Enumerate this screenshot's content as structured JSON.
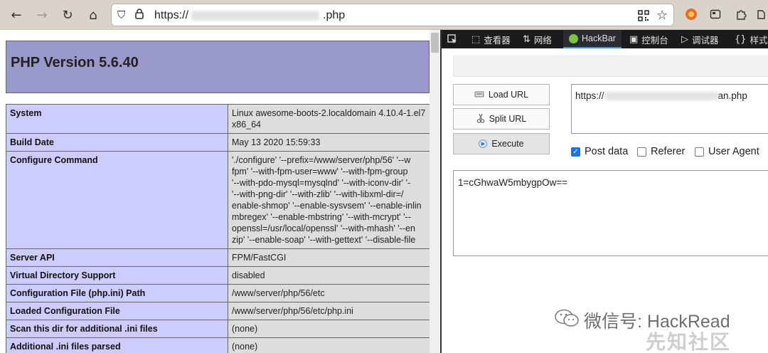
{
  "browser": {
    "url_prefix": "https://",
    "url_suffix": ".php",
    "icons": {
      "back": "←",
      "forward": "→",
      "reload": "↻",
      "home": "⌂",
      "shield": "⛉",
      "lock": "🔒",
      "qr": "▦",
      "star": "☆"
    }
  },
  "phpinfo": {
    "title": "PHP Version 5.6.40",
    "rows": [
      {
        "key": "System",
        "value": "Linux awesome-boots-2.localdomain 4.10.4-1.el7",
        "value2": "x86_64"
      },
      {
        "key": "Build Date",
        "value": "May 13 2020 15:59:33"
      },
      {
        "key": "Configure Command",
        "lines": [
          "'./configure' '--prefix=/www/server/php/56' '--w",
          "fpm' '--with-fpm-user=www' '--with-fpm-group",
          "'--with-pdo-mysql=mysqlnd' '--with-iconv-dir' '-",
          "'--with-png-dir' '--with-zlib' '--with-libxml-dir=/",
          "enable-shmop' '--enable-sysvsem' '--enable-inlin",
          "mbregex' '--enable-mbstring' '--with-mcrypt' '--",
          "openssl=/usr/local/openssl' '--with-mhash' '--en",
          "zip' '--enable-soap' '--with-gettext' '--disable-file"
        ]
      },
      {
        "key": "Server API",
        "value": "FPM/FastCGI"
      },
      {
        "key": "Virtual Directory Support",
        "value": "disabled"
      },
      {
        "key": "Configuration File (php.ini) Path",
        "value": "/www/server/php/56/etc"
      },
      {
        "key": "Loaded Configuration File",
        "value": "/www/server/php/56/etc/php.ini"
      },
      {
        "key": "Scan this dir for additional .ini files",
        "value": "(none)"
      },
      {
        "key": "Additional .ini files parsed",
        "value": "(none)"
      }
    ]
  },
  "devtools": {
    "tabs": [
      {
        "icon": "⬚",
        "label": "查看器"
      },
      {
        "icon": "⇅",
        "label": "网络"
      },
      {
        "icon": "",
        "label": "HackBar"
      },
      {
        "icon": "▣",
        "label": "控制台"
      },
      {
        "icon": "▷",
        "label": "调试器"
      },
      {
        "icon": "{}",
        "label": "样式"
      }
    ],
    "inspect_icon": "⬉"
  },
  "hackbar": {
    "load_url": "Load URL",
    "split_url": "Split URL",
    "execute": "Execute",
    "url_prefix": "https://",
    "url_suffix": "an.php",
    "post_data_label": "Post data",
    "referer_label": "Referer",
    "user_agent_label": "User Agent",
    "post_body": "1=cGhwaW5mbygpOw=="
  },
  "watermark": {
    "text": "微信号: HackRead",
    "text2": "先知社区"
  }
}
